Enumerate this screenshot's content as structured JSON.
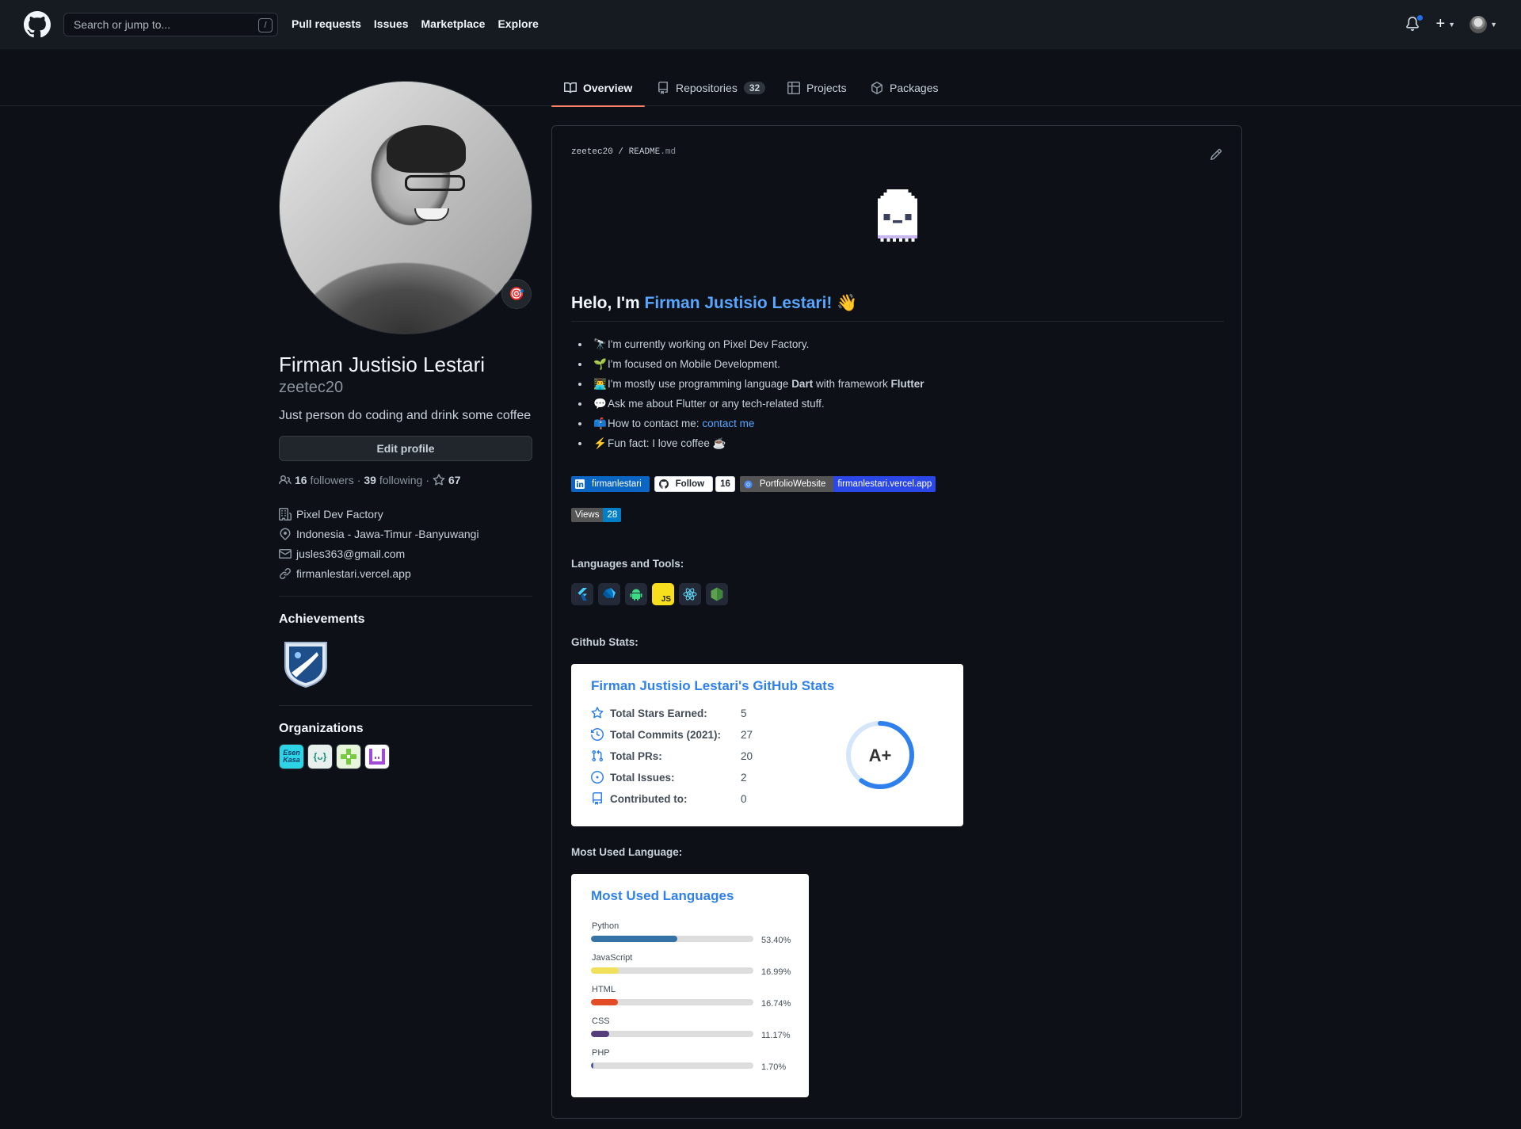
{
  "header": {
    "search_placeholder": "Search or jump to...",
    "slash_hint": "/",
    "nav": [
      "Pull requests",
      "Issues",
      "Marketplace",
      "Explore"
    ],
    "plus": "+"
  },
  "tabs": [
    {
      "label": "Overview",
      "icon": "book-icon",
      "active": true
    },
    {
      "label": "Repositories",
      "icon": "repo-icon",
      "count": "32"
    },
    {
      "label": "Projects",
      "icon": "table-icon"
    },
    {
      "label": "Packages",
      "icon": "package-icon"
    }
  ],
  "profile": {
    "name": "Firman Justisio Lestari",
    "login": "zeetec20",
    "bio": "Just person do coding and drink some coffee",
    "edit_label": "Edit profile",
    "followers_count": "16",
    "followers_label": "followers",
    "following_count": "39",
    "following_label": "following",
    "stars_count": "67",
    "dot": "·",
    "company": "Pixel Dev Factory",
    "location": "Indonesia - Jawa-Timur -Banyuwangi",
    "email": "jusles363@gmail.com",
    "website": "firmanlestari.vercel.app",
    "status_emoji": "🎯"
  },
  "achievements": {
    "title": "Achievements"
  },
  "organizations": {
    "title": "Organizations",
    "items": [
      {
        "label": "Esen Kasa",
        "bg": "#2dd4e6"
      },
      {
        "label": "{ᴗ}",
        "bg": "#e8f0ee"
      },
      {
        "label": "",
        "bg": "#e6f5dc"
      },
      {
        "label": "",
        "bg": "#ffffff"
      }
    ]
  },
  "readme": {
    "owner": "zeetec20",
    "sep": "/",
    "file": "README",
    "ext": ".md",
    "hello_prefix": "Helo, I'm ",
    "hello_name": "Firman Justisio Lestari!",
    "hello_emoji": "👋",
    "bullets": [
      {
        "emoji": "🔭",
        "text": "I'm currently working on Pixel Dev Factory."
      },
      {
        "emoji": "🌱",
        "text": "I'm focused on Mobile Development."
      },
      {
        "emoji": "👨‍💻",
        "pre": "I'm mostly use programming language ",
        "b1": "Dart",
        "mid": " with framework ",
        "b2": "Flutter"
      },
      {
        "emoji": "💬",
        "text": "Ask me about Flutter or any tech-related stuff."
      },
      {
        "emoji": "📫",
        "pre": "How to contact me: ",
        "link": "contact me"
      },
      {
        "emoji": "⚡",
        "text": "Fun fact: I love coffee ☕"
      }
    ],
    "shields": {
      "linkedin": "firmanlestari",
      "follow": "Follow",
      "follow_count": "16",
      "portfolio_label": "PortfolioWebsite",
      "portfolio_value": "firmanlestari.vercel.app",
      "views_label": "Views",
      "views_count": "28"
    },
    "languages_tools_title": "Languages and Tools:",
    "github_stats_title": "Github Stats:",
    "most_used_title": "Most Used Language:"
  },
  "stats_card": {
    "title": "Firman Justisio Lestari's GitHub Stats",
    "rows": [
      {
        "label": "Total Stars Earned:",
        "value": "5",
        "icon": "star-icon"
      },
      {
        "label": "Total Commits (2021):",
        "value": "27",
        "icon": "history-icon"
      },
      {
        "label": "Total PRs:",
        "value": "20",
        "icon": "pr-icon"
      },
      {
        "label": "Total Issues:",
        "value": "2",
        "icon": "issue-icon"
      },
      {
        "label": "Contributed to:",
        "value": "0",
        "icon": "repo-icon"
      }
    ],
    "grade": "A+",
    "ring_fraction": 0.6,
    "accent": "#2f80ed"
  },
  "languages_card": {
    "title": "Most Used Languages",
    "items": [
      {
        "name": "Python",
        "pct": "53.40%",
        "value": 53.4,
        "color": "#3572A5"
      },
      {
        "name": "JavaScript",
        "pct": "16.99%",
        "value": 16.99,
        "color": "#f1e05a"
      },
      {
        "name": "HTML",
        "pct": "16.74%",
        "value": 16.74,
        "color": "#e34c26"
      },
      {
        "name": "CSS",
        "pct": "11.17%",
        "value": 11.17,
        "color": "#563d7c"
      },
      {
        "name": "PHP",
        "pct": "1.70%",
        "value": 1.7,
        "color": "#4F5D95"
      }
    ]
  }
}
